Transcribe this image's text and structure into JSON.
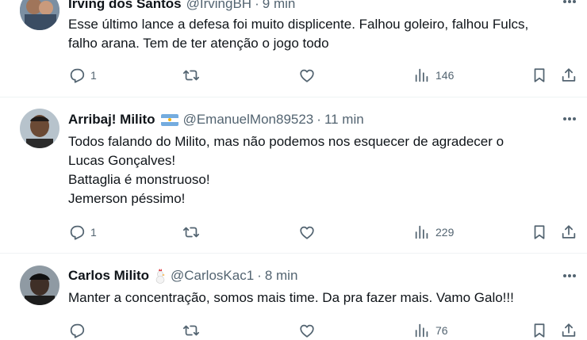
{
  "tweets": [
    {
      "name": "Irving dos Santos",
      "handle": "@IrvingBH",
      "dot": "·",
      "time": "9 min",
      "lines": [
        "Esse último lance a defesa foi muito displicente. Falhou goleiro, falhou Fulcs,",
        "falho arana. Tem de ter atenção o jogo todo"
      ],
      "replies": "1",
      "views": "146"
    },
    {
      "name": "Arribaj! Milito",
      "handle": "@EmanuelMon89523",
      "dot": "·",
      "time": "11 min",
      "lines": [
        "Todos falando do Milito, mas não podemos nos esquecer de agradecer o",
        "Lucas Gonçalves!",
        "Battaglia é monstruoso!",
        "Jemerson péssimo!"
      ],
      "replies": "1",
      "views": "229",
      "badge": "argentina-flag"
    },
    {
      "name": "Carlos Milito",
      "handle": "@CarlosKac1",
      "dot": "·",
      "time": "8 min",
      "lines": [
        "Manter a concentração, somos mais time. Da pra fazer mais. Vamo Galo!!!"
      ],
      "replies": "",
      "views": "76",
      "badge": "chicken-emoji"
    }
  ],
  "icons": {
    "reply": "reply-icon",
    "retweet": "retweet-icon",
    "like": "like-icon",
    "views": "views-icon",
    "bookmark": "bookmark-icon",
    "share": "share-icon",
    "more": "more-icon"
  },
  "colors": {
    "text": "#0f1419",
    "secondary": "#536471",
    "divider": "#eff3f4"
  }
}
